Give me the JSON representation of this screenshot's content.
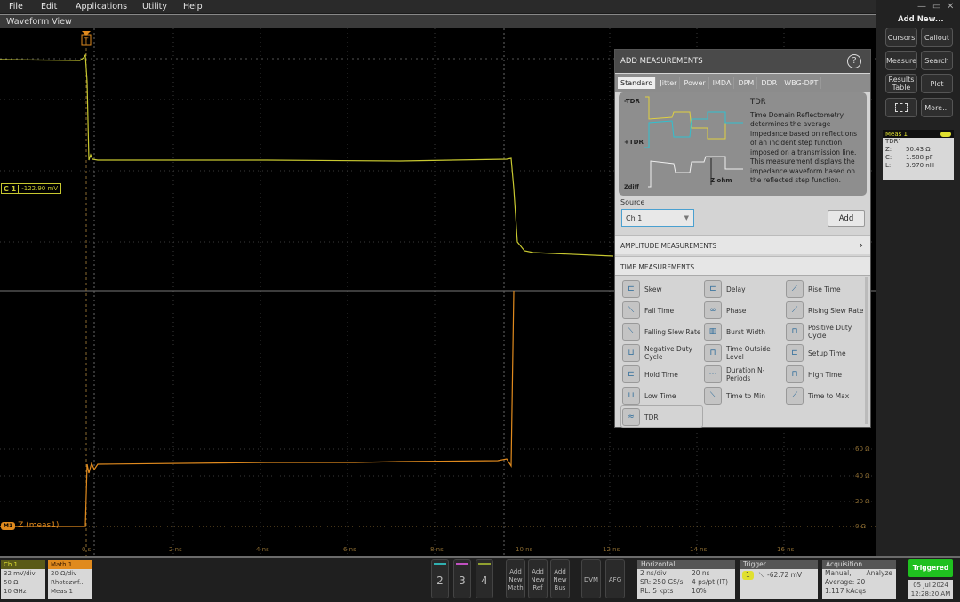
{
  "menu": [
    "File",
    "Edit",
    "Applications",
    "Utility",
    "Help"
  ],
  "waveform_view": {
    "title": "Waveform View",
    "trigger_marker": "T",
    "ch1_label": "C 1",
    "ch1_offset": "-122.90 mV",
    "math_badge": "M1",
    "math_label": "Z (meas1)",
    "x_ticks": [
      "0 s",
      "2 ns",
      "4 ns",
      "6 ns",
      "8 ns",
      "10 ns",
      "12 ns",
      "14 ns",
      "16 ns"
    ],
    "y_ticks_math": [
      "60 Ω",
      "40 Ω",
      "20 Ω",
      "0 Ω"
    ],
    "colors": {
      "ch1": "#c8c830",
      "math": "#e08a1e"
    }
  },
  "add_measurements": {
    "title": "ADD MEASUREMENTS",
    "help": "?",
    "tabs": [
      "Standard",
      "Jitter",
      "Power",
      "IMDA",
      "DPM",
      "DDR",
      "WBG-DPT"
    ],
    "active_tab": "Standard",
    "diagram_labels": {
      "neg": "-TDR",
      "pos": "+TDR",
      "zdiff": "Zdiff",
      "zohm": "Z ohm"
    },
    "desc_title": "TDR",
    "desc_text": "Time Domain Reflectometry determines the average impedance based on reflections of an incident step function imposed on a transmission line. This measurement displays the impedance waveform based on the reflected step function.",
    "source_label": "Source",
    "source_value": "Ch 1",
    "add_label": "Add",
    "amplitude_section": "AMPLITUDE MEASUREMENTS",
    "time_section": "TIME MEASUREMENTS",
    "time_items": [
      "Skew",
      "Delay",
      "Rise Time",
      "Fall Time",
      "Phase",
      "Rising Slew Rate",
      "Falling Slew Rate",
      "Burst Width",
      "Positive Duty Cycle",
      "Negative Duty Cycle",
      "Time Outside Level",
      "Setup Time",
      "Hold Time",
      "Duration N-Periods",
      "High Time",
      "Low Time",
      "Time to Min",
      "Time to Max",
      "TDR"
    ]
  },
  "right_panel": {
    "add_new": "Add New...",
    "buttons": [
      "Cursors",
      "Callout",
      "Measure",
      "Search",
      "Results Table",
      "Plot",
      "",
      "More..."
    ],
    "meas": {
      "title": "Meas 1",
      "badge": "1",
      "type": "TDR'",
      "rows": [
        [
          "Z:",
          "50.43 Ω"
        ],
        [
          "C:",
          "1.588 pF"
        ],
        [
          "L:",
          "3.970 nH"
        ]
      ]
    }
  },
  "bottom": {
    "ch1": {
      "title": "Ch 1",
      "lines": [
        "32 mV/div",
        "50 Ω",
        "10 GHz"
      ]
    },
    "math1": {
      "title": "Math 1",
      "lines": [
        "20 Ω/div",
        "Rhotozwf...",
        "Meas 1"
      ]
    },
    "channels": [
      "2",
      "3",
      "4"
    ],
    "add_buttons": [
      "Add New Math",
      "Add New Ref",
      "Add New Bus"
    ],
    "tools": [
      "DVM",
      "AFG"
    ],
    "horizontal": {
      "title": "Horizontal",
      "rows": [
        [
          "2 ns/div",
          "20 ns"
        ],
        [
          "SR: 250 GS/s",
          "4 ps/pt (IT)"
        ],
        [
          "RL: 5 kpts",
          "10%"
        ]
      ]
    },
    "trigger": {
      "title": "Trigger",
      "source": "1",
      "level": "-62.72 mV"
    },
    "acquisition": {
      "title": "Acquisition",
      "rows": [
        [
          "Manual,",
          "Analyze"
        ],
        [
          "Average: 20",
          ""
        ],
        [
          "1.117 kAcqs",
          ""
        ]
      ]
    },
    "status": "Triggered",
    "date": "05 Jul 2024",
    "time": "12:28:20 AM"
  }
}
